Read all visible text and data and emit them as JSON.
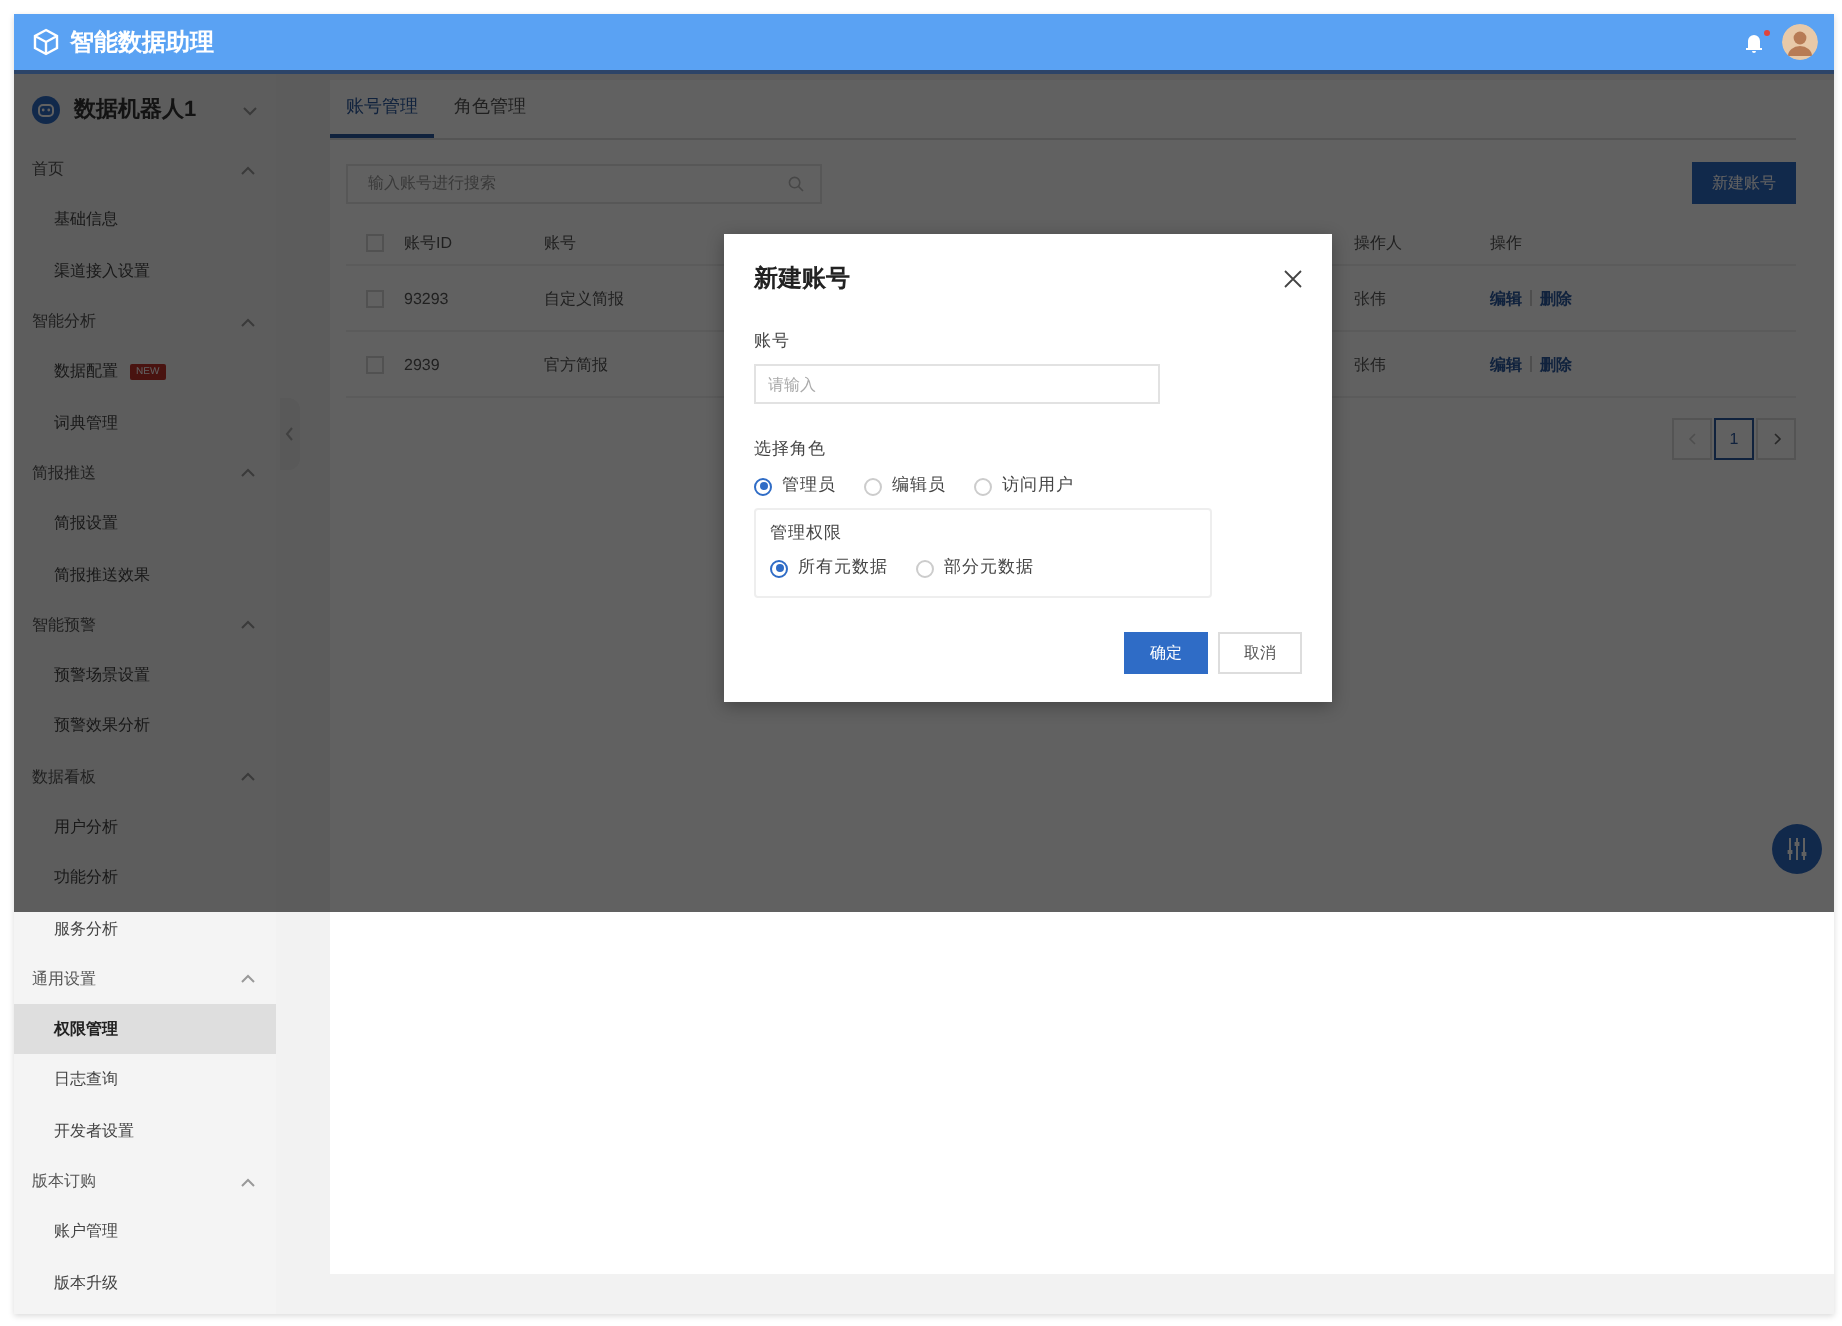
{
  "header": {
    "title": "智能数据助理",
    "notification_unread": true
  },
  "sidebar": {
    "bot_name": "数据机器人1",
    "groups": [
      {
        "label": "首页",
        "expanded": true,
        "children": [
          {
            "label": "基础信息",
            "selected": false
          },
          {
            "label": "渠道接入设置",
            "selected": false
          }
        ]
      },
      {
        "label": "智能分析",
        "expanded": true,
        "children": [
          {
            "label": "数据配置",
            "selected": false,
            "badge": "NEW"
          },
          {
            "label": "词典管理",
            "selected": false
          }
        ]
      },
      {
        "label": "简报推送",
        "expanded": true,
        "children": [
          {
            "label": "简报设置",
            "selected": false
          },
          {
            "label": "简报推送效果",
            "selected": false
          }
        ]
      },
      {
        "label": "智能预警",
        "expanded": true,
        "children": [
          {
            "label": "预警场景设置",
            "selected": false
          },
          {
            "label": "预警效果分析",
            "selected": false
          }
        ]
      },
      {
        "label": "数据看板",
        "expanded": true,
        "children": [
          {
            "label": "用户分析",
            "selected": false
          },
          {
            "label": "功能分析",
            "selected": false
          },
          {
            "label": "服务分析",
            "selected": false
          }
        ]
      },
      {
        "label": "通用设置",
        "expanded": true,
        "children": [
          {
            "label": "权限管理",
            "selected": true
          },
          {
            "label": "日志查询",
            "selected": false
          },
          {
            "label": "开发者设置",
            "selected": false
          }
        ]
      },
      {
        "label": "版本订购",
        "expanded": true,
        "children": [
          {
            "label": "账户管理",
            "selected": false
          },
          {
            "label": "版本升级",
            "selected": false
          }
        ]
      }
    ]
  },
  "tabs": [
    {
      "label": "账号管理",
      "selected": true
    },
    {
      "label": "角色管理",
      "selected": false
    }
  ],
  "search": {
    "placeholder": "输入账号进行搜索"
  },
  "new_button": "新建账号",
  "table": {
    "all_checked": false,
    "columns": [
      "账号ID",
      "账号",
      "操作人",
      "操作"
    ],
    "rows": [
      {
        "checked": false,
        "id": "93293",
        "account": "自定义简报",
        "operator": "张伟",
        "actions": [
          "编辑",
          "删除"
        ]
      },
      {
        "checked": false,
        "id": "2939",
        "account": "官方简报",
        "operator": "张伟",
        "actions": [
          "编辑",
          "删除"
        ]
      }
    ]
  },
  "pagination": {
    "prev_disabled": true,
    "next_disabled": false,
    "pages": [
      {
        "label": "1",
        "selected": true
      }
    ]
  },
  "modal": {
    "title": "新建账号",
    "field_label": "账号",
    "placeholder": "请输入",
    "role_label": "选择角色",
    "roles": [
      {
        "label": "管理员",
        "selected": true
      },
      {
        "label": "编辑员",
        "selected": false
      },
      {
        "label": "访问用户",
        "selected": false
      }
    ],
    "scope_label": "管理权限",
    "scopes": [
      {
        "label": "所有元数据",
        "selected": true
      },
      {
        "label": "部分元数据",
        "selected": false
      }
    ],
    "buttons": [
      {
        "label": "确定",
        "kind": "primary"
      },
      {
        "label": "取消",
        "kind": "default"
      }
    ]
  }
}
